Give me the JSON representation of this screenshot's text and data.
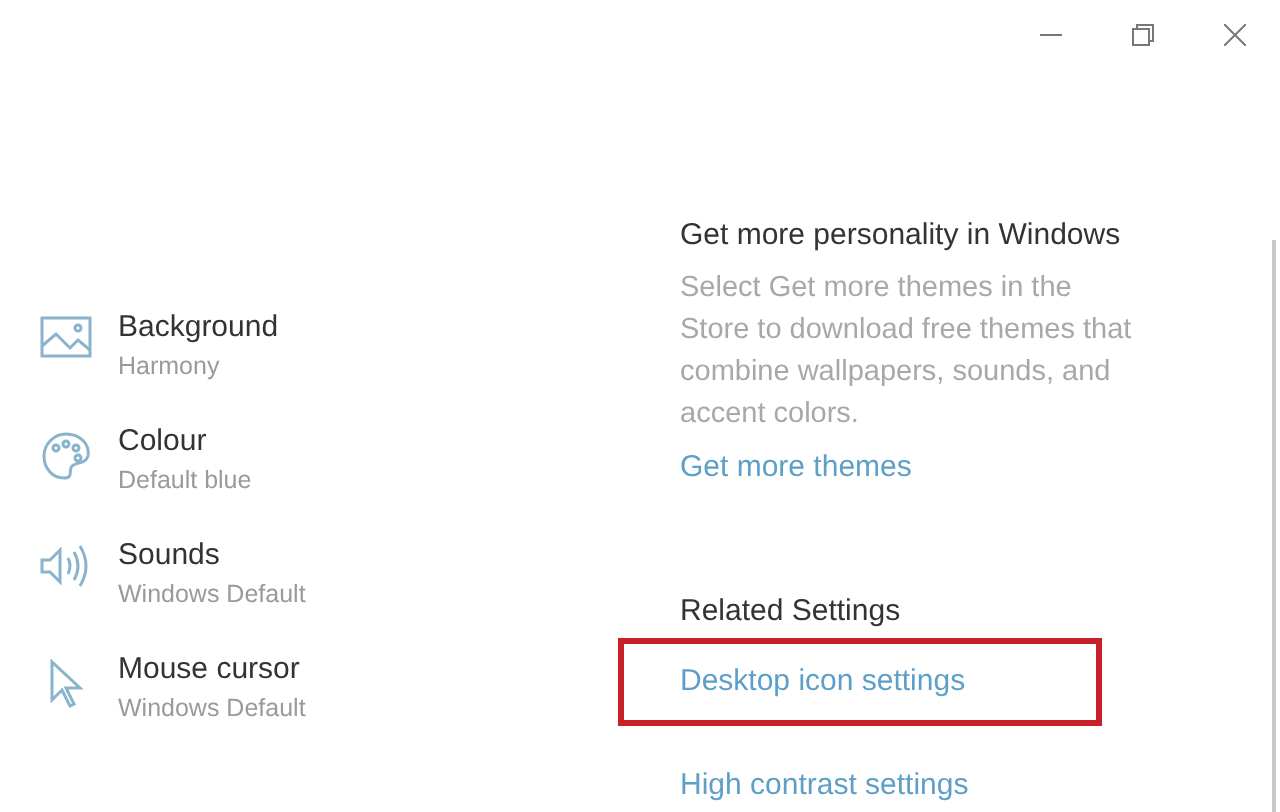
{
  "window_controls": [
    {
      "kind": "minimize"
    },
    {
      "kind": "restore"
    },
    {
      "kind": "close"
    }
  ],
  "theme_items": [
    {
      "kind": "picture",
      "title": "Background",
      "value": "Harmony"
    },
    {
      "kind": "palette",
      "title": "Colour",
      "value": "Default blue"
    },
    {
      "kind": "speaker",
      "title": "Sounds",
      "value": "Windows Default"
    },
    {
      "kind": "cursor",
      "title": "Mouse cursor",
      "value": "Windows Default"
    }
  ],
  "personality": {
    "heading": "Get more personality in Windows",
    "text": "Select Get more themes in the Store to download free themes that combine wallpapers, sounds, and accent colors.",
    "link": "Get more themes"
  },
  "related_settings": {
    "heading": "Related Settings",
    "links": [
      {
        "label": "Desktop icon settings",
        "highlighted": true
      },
      {
        "label": "High contrast settings",
        "highlighted": false
      }
    ]
  }
}
